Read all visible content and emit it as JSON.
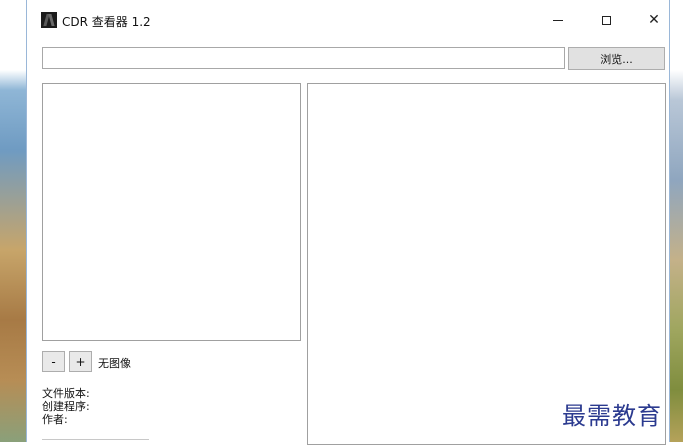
{
  "window": {
    "title": "CDR 查看器 1.2",
    "controls": {
      "minimize": "minimize-icon",
      "maximize": "maximize-icon",
      "close": "close-icon",
      "close_glyph": "✕"
    }
  },
  "path_row": {
    "input_value": "",
    "browse_label": "浏览..."
  },
  "zoom": {
    "minus_label": "-",
    "plus_label": "+",
    "status": "无图像"
  },
  "info": {
    "file_version_label": "文件版本:",
    "creator_label": "创建程序:",
    "author_label": "作者:"
  },
  "watermark": {
    "text": "最需教育"
  },
  "colors": {
    "watermark": "#2b3a8f",
    "border": "#a0a0a0",
    "button_face": "#e1e1e1"
  }
}
